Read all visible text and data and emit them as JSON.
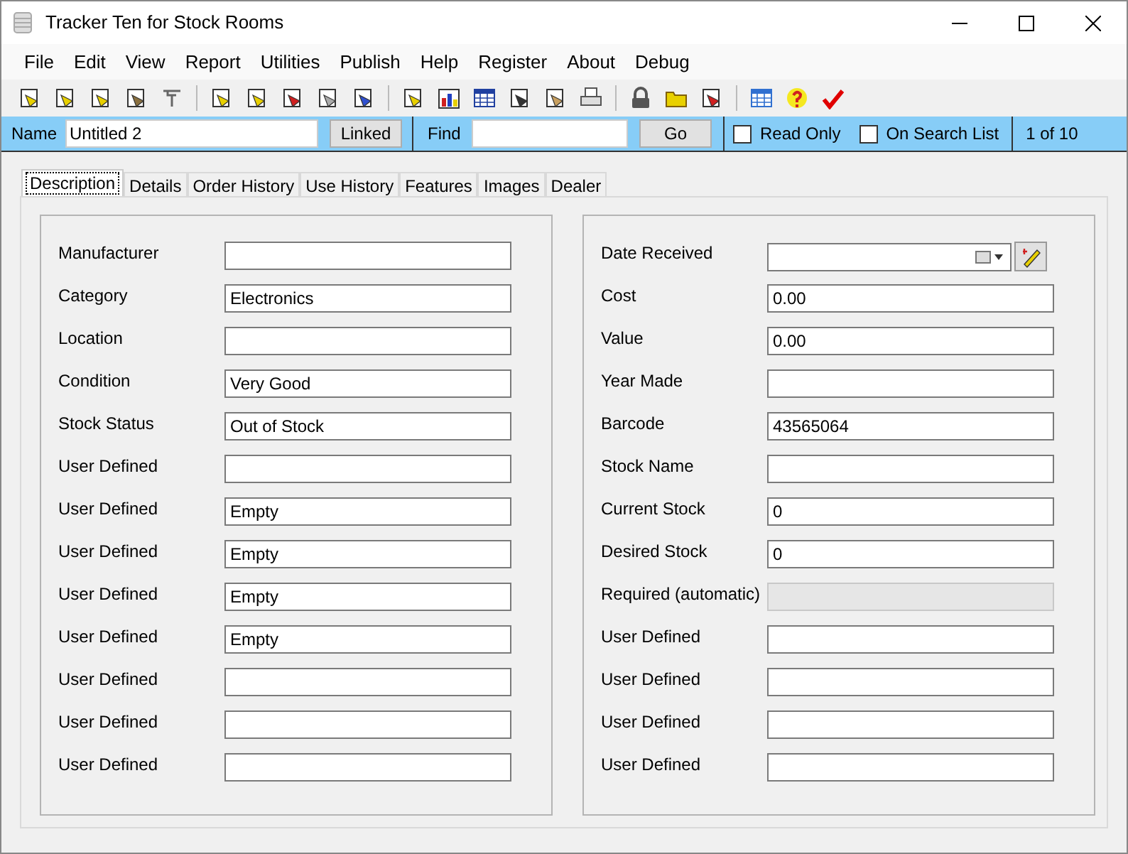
{
  "window": {
    "title": "Tracker Ten for Stock Rooms"
  },
  "menu": [
    "File",
    "Edit",
    "View",
    "Report",
    "Utilities",
    "Publish",
    "Help",
    "Register",
    "About",
    "Debug"
  ],
  "searchbar": {
    "name_label": "Name",
    "name_value": "Untitled 2",
    "linked_button": "Linked",
    "find_label": "Find",
    "go_button": "Go",
    "read_only": {
      "label": "Read Only",
      "checked": false
    },
    "on_search_list": {
      "label": "On Search List",
      "checked": false
    },
    "record_count": "1 of 10"
  },
  "tabs": [
    {
      "label": "Description",
      "selected": true
    },
    {
      "label": "Details",
      "selected": false
    },
    {
      "label": "Order History",
      "selected": false
    },
    {
      "label": "Use History",
      "selected": false
    },
    {
      "label": "Features",
      "selected": false
    },
    {
      "label": "Images",
      "selected": false
    },
    {
      "label": "Dealer",
      "selected": false
    }
  ],
  "left_fields": [
    {
      "label": "Manufacturer",
      "kind": "text"
    },
    {
      "label": "Category",
      "value": "Electronics",
      "kind": "text"
    },
    {
      "label": "Location",
      "kind": "text"
    },
    {
      "label": "Condition",
      "value": "Very Good",
      "kind": "text"
    },
    {
      "label": "Stock Status",
      "value": "Out of Stock",
      "kind": "text"
    },
    {
      "label": "User Defined",
      "kind": "text"
    },
    {
      "label": "User Defined",
      "value": "Empty",
      "kind": "text"
    },
    {
      "label": "User Defined",
      "value": "Empty",
      "kind": "text"
    },
    {
      "label": "User Defined",
      "value": "Empty",
      "kind": "text"
    },
    {
      "label": "User Defined",
      "value": "Empty",
      "kind": "text"
    },
    {
      "label": "User Defined",
      "kind": "text"
    },
    {
      "label": "User Defined",
      "kind": "text"
    },
    {
      "label": "User Defined",
      "kind": "text"
    }
  ],
  "right_fields": [
    {
      "label": "Date Received",
      "kind": "date"
    },
    {
      "label": "Cost",
      "value": "0.00",
      "kind": "text"
    },
    {
      "label": "Value",
      "value": "0.00",
      "kind": "text"
    },
    {
      "label": "Year Made",
      "kind": "text"
    },
    {
      "label": "Barcode",
      "value": "43565064",
      "kind": "text"
    },
    {
      "label": "Stock Name",
      "kind": "text"
    },
    {
      "label": "Current Stock",
      "value": "0",
      "kind": "text"
    },
    {
      "label": "Desired Stock",
      "value": "0",
      "kind": "text"
    },
    {
      "label": "Required (automatic)",
      "kind": "disabled"
    },
    {
      "label": "User Defined",
      "kind": "text"
    },
    {
      "label": "User Defined",
      "kind": "text"
    },
    {
      "label": "User Defined",
      "kind": "text"
    },
    {
      "label": "User Defined",
      "kind": "text"
    }
  ]
}
